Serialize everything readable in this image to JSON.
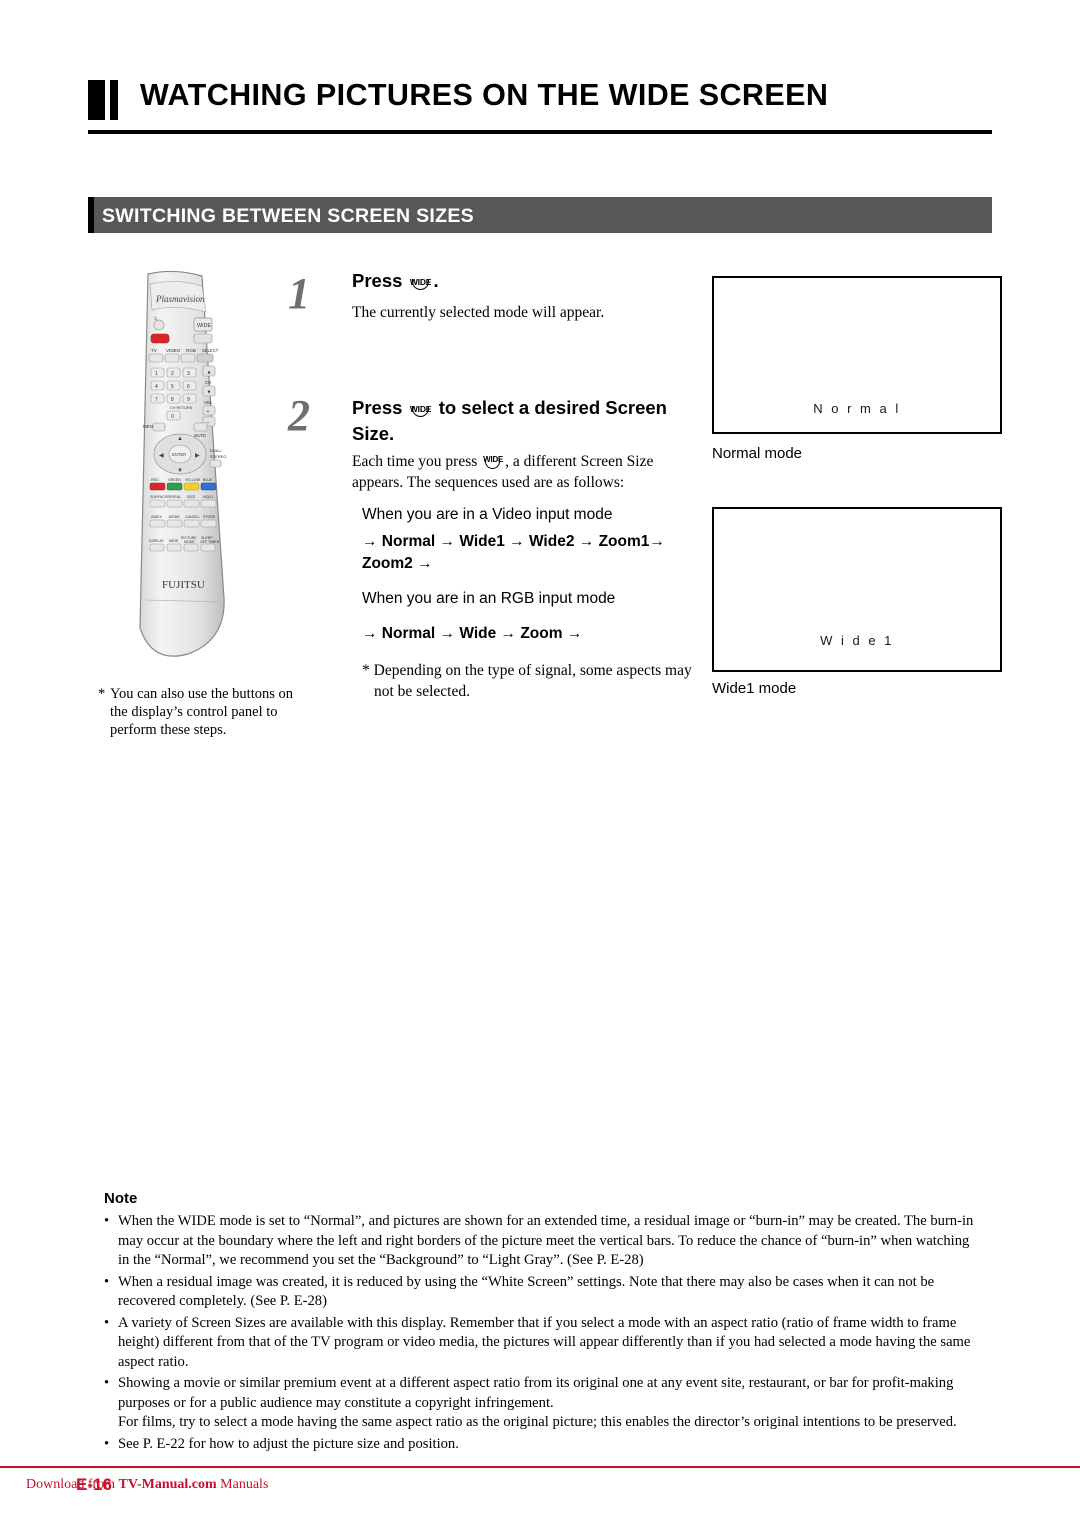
{
  "header": {
    "title": "WATCHING PICTURES ON THE WIDE SCREEN",
    "section": "SWITCHING BETWEEN SCREEN SIZES"
  },
  "steps": [
    {
      "number": "1",
      "heading_pre": "Press",
      "heading_post": ".",
      "button_label": "WIDE",
      "body": "The currently selected mode will appear."
    },
    {
      "number": "2",
      "heading_pre": "Press",
      "heading_post": "to select a desired Screen Size.",
      "button_label": "WIDE",
      "body_1": "Each time you press",
      "body_2": ", a different Screen Size appears.  The sequences used are as follows:",
      "video_mode_label": "When you are in a Video input mode",
      "video_sequence_line1": "→ Normal → Wide1 → Wide2 → Zoom1→",
      "video_sequence_line2": "Zoom2 →",
      "rgb_mode_label": "When you are in an RGB input mode",
      "rgb_sequence": "→ Normal → Wide → Zoom →",
      "depend_note": "* Depending on the type of signal, some aspects may not be selected."
    }
  ],
  "screens": [
    {
      "inner_label": "N o r m a l",
      "caption": "Normal mode"
    },
    {
      "inner_label": "W i d e 1",
      "caption": "Wide1 mode"
    }
  ],
  "left_footnote": {
    "star": "*",
    "text": "You can also use the buttons on the display’s control panel to perform these steps."
  },
  "remote": {
    "brand_top": "Plasmavision",
    "brand_bottom": "FUJITSU",
    "wide_key": "WIDE",
    "source_keys": [
      "TV",
      "VIDEO",
      "RGB",
      "SELECT"
    ],
    "numeric_keys": [
      "1",
      "2",
      "3",
      "4",
      "5",
      "6",
      "7",
      "8",
      "9",
      "0"
    ],
    "side_keys": [
      "CH",
      "VOL"
    ],
    "menu_key": "MENU",
    "mute_key": "MUTE",
    "enter_key": "ENTER",
    "return_key": "CH RETURN",
    "dual_key": "DUAL/ STEREO",
    "color_keys": [
      "RED",
      "GREEN",
      "YELLOW",
      "BLUE"
    ],
    "function_keys": [
      "SURFACE",
      "REVEAL",
      "SIZE",
      "HOLD"
    ],
    "function_keys2": [
      "INDEX",
      "MODE",
      "CANCEL",
      "STORE"
    ],
    "bottom_keys": [
      "DISPLAY",
      "WIDE",
      "PICTURE MODE",
      "SLEEP",
      "OFF TIMER"
    ]
  },
  "note": {
    "title": "Note",
    "items": [
      "When the WIDE mode is set to “Normal”, and pictures are shown for an extended time, a residual image or “burn-in” may be created. The burn-in may occur at the boundary where the left and right borders of the picture meet the vertical bars. To reduce the chance of “burn-in” when watching in the “Normal”, we recommend you set the “Background” to “Light Gray”.  (See P. E-28)",
      "When a residual image was created, it is reduced by using the “White Screen” settings. Note that there may also be cases when it can not be recovered completely. (See P. E-28)",
      "A variety of Screen Sizes are available with this display.  Remember that if you select a mode with an aspect ratio (ratio of frame width to frame height) different from that of the TV program or video media, the pictures will appear differently than if you had selected a mode having the same aspect ratio.",
      "Showing a movie or similar premium event at a different aspect ratio from its original one at any event site, restaurant, or bar for profit-making purposes or for a public audience may constitute a copyright infringement.",
      "See P. E-22 for how to adjust the picture size and position."
    ],
    "sub_item": "For films, try to select a mode having the same aspect ratio as the original picture; this enables the director’s original intentions to be preserved."
  },
  "footer": {
    "page": "E-16",
    "link_pre": "Download from ",
    "link_bold": "TV-Manual.com",
    "link_post": " Manuals",
    "accent_color": "#c8102e"
  }
}
